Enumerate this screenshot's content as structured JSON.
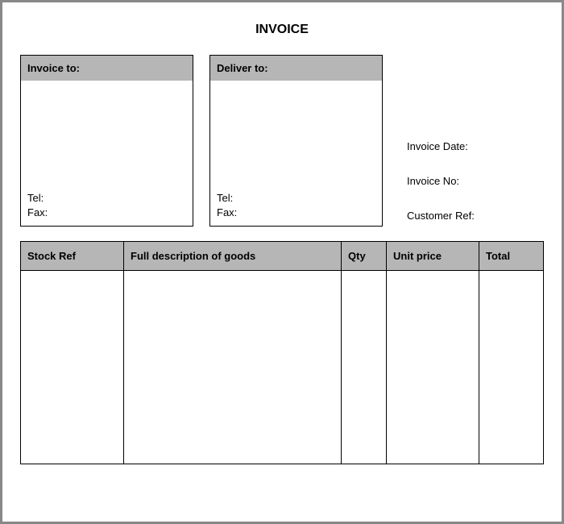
{
  "title": "INVOICE",
  "invoice_to": {
    "header": "Invoice to:",
    "tel_label": "Tel:",
    "fax_label": "Fax:"
  },
  "deliver_to": {
    "header": "Deliver to:",
    "tel_label": "Tel:",
    "fax_label": "Fax:"
  },
  "meta": {
    "date_label": "Invoice Date:",
    "no_label": "Invoice No:",
    "ref_label": "Customer Ref:"
  },
  "columns": {
    "stock": "Stock Ref",
    "desc": "Full description of goods",
    "qty": "Qty",
    "unit": "Unit price",
    "total": "Total"
  }
}
